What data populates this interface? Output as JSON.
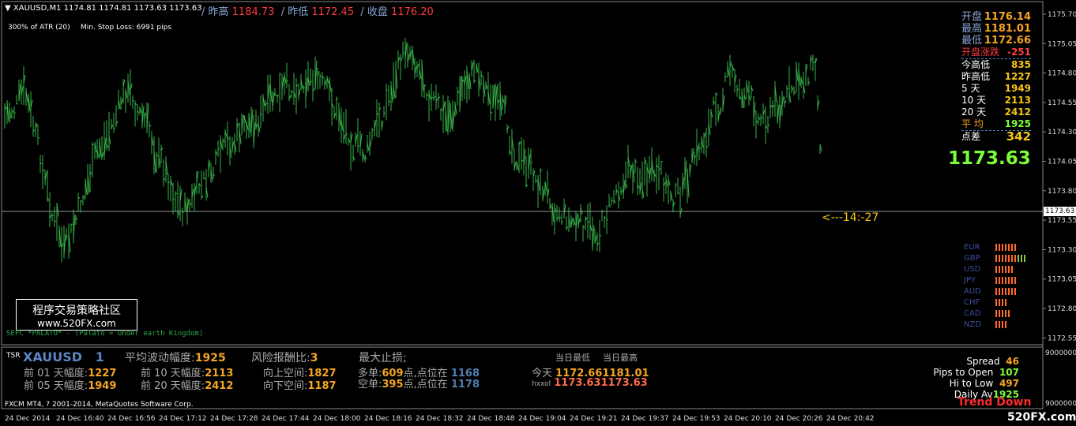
{
  "header": {
    "symbol_line": "XAUUSD,M1  1174.81 1174.81 1173.63 1173.63",
    "atr_info": "300% of ATR (20)",
    "stop_loss": "Min. Stop Loss:   6991 pips",
    "prev_high_label": "/ 昨高",
    "prev_high_value": "1184.73",
    "prev_low_label": "/ 昨低",
    "prev_low_value": "1172.45",
    "close_label": "/ 收盘",
    "close_value": "1176.20"
  },
  "right_panel": {
    "rows": [
      {
        "label": "开盘",
        "value": "1176.14"
      },
      {
        "label": "最高",
        "value": "1181.01"
      },
      {
        "label": "最低",
        "value": "1172.66"
      },
      {
        "label": "开盘涨跌",
        "value": "-251"
      },
      {
        "label": "今高低",
        "value": "835"
      },
      {
        "label": "昨高低",
        "value": "1227"
      },
      {
        "label": "5    天",
        "value": "1949"
      },
      {
        "label": "10  天",
        "value": "2113"
      },
      {
        "label": "20  天",
        "value": "2412"
      },
      {
        "label": "平    均",
        "value": "1925"
      },
      {
        "label": "点差",
        "value": "342"
      }
    ],
    "big_price": "1173.63"
  },
  "countdown": "<---14:-27",
  "currencies": [
    "EUR",
    "GBP",
    "USD",
    "JPY",
    "AUD",
    "CHF",
    "CAD",
    "NZD"
  ],
  "currency_strength": [
    7,
    10,
    6,
    7,
    7,
    4,
    5,
    4
  ],
  "y_axis": [
    "1175.70",
    "1175.05",
    "1174.80",
    "1174.55",
    "1174.30",
    "1174.05",
    "1173.80",
    "1173.55",
    "1173.30",
    "1173.05",
    "1172.80",
    "1172.55"
  ],
  "current_price_tag": "1173.63",
  "logo": {
    "line1": "程序交易策略社区",
    "line2": "www.520FX.com"
  },
  "indicator_label": "SEFC *PALATO* - (Palato = Under earth Kingdom)",
  "sub_panel": {
    "tag": "TSR",
    "symbol": "XAUUSD",
    "count": "1",
    "avg_label": "平均波动幅度:",
    "avg_value": "1925",
    "risk_label": "风险报酬比:",
    "risk_value": "3",
    "max_stop_label": "最大止损;",
    "day_low_header": "当日最低",
    "day_high_header": "当日最高",
    "r1_l1": "前 01 天幅度:",
    "r1_v1": "1227",
    "r1_l2": "前 10 天幅度:",
    "r1_v2": "2113",
    "up_label": "向上空间:",
    "up_value": "1827",
    "long_label": "多单:",
    "long_pts": "609",
    "long_mid": "点,点位在",
    "long_value": "1168",
    "today_label": "今天",
    "today_low": "1172.66",
    "today_high": "1181.01",
    "r2_l1": "前 05 天幅度:",
    "r2_v1": "1949",
    "r2_l2": "前 20 天幅度:",
    "r2_v2": "2412",
    "down_label": "向下空间:",
    "down_value": "1187",
    "short_label": "空单:",
    "short_pts": "395",
    "short_mid": "点,点位在",
    "short_value": "1178",
    "hist_label": "hxxol",
    "hist_low": "1173.63",
    "hist_high": "1173.63",
    "spread_label": "Spread",
    "spread_value": "46",
    "pips_open_label": "Pips to Open",
    "pips_open_value": "107",
    "hi_low_label": "Hi to Low",
    "hi_low_value": "497",
    "daily_label": "Daily Av",
    "daily_value": "1925",
    "trend": "Trend Down",
    "axis_top": "9000000",
    "axis_bottom": "9000000"
  },
  "footer": {
    "copyright": "FXCM MT4, ? 2001-2014, MetaQuotes Software Corp.",
    "site": "520FX.com"
  },
  "x_axis": [
    "24 Dec 2014",
    "24 Dec 16:40",
    "24 Dec 16:56",
    "24 Dec 17:12",
    "24 Dec 17:28",
    "24 Dec 17:44",
    "24 Dec 18:00",
    "24 Dec 18:16",
    "24 Dec 18:32",
    "24 Dec 18:48",
    "24 Dec 19:04",
    "24 Dec 19:21",
    "24 Dec 19:37",
    "24 Dec 19:53",
    "24 Dec 20:10",
    "24 Dec 20:26",
    "24 Dec 20:42"
  ],
  "colors": {
    "bars": "#39b54a",
    "label_orange": "#f5a623",
    "label_red": "#ff3b3b",
    "accent_green": "#7cff3a",
    "axis_blue": "#4f7fb3"
  }
}
